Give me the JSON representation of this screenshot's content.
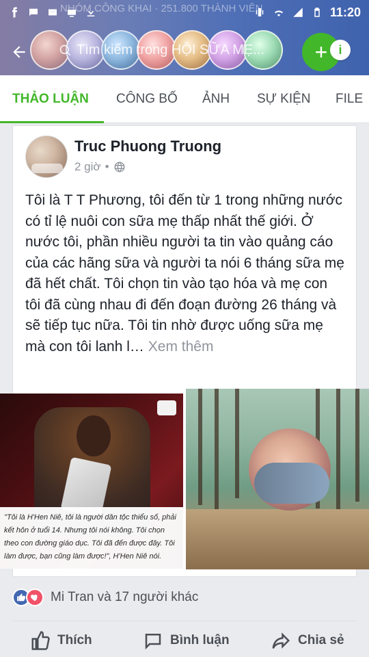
{
  "status_bar": {
    "time": "11:20",
    "group_marquee": "NHÓM CÔNG KHAI · 251.800 THÀNH VIÊN",
    "icons": [
      "facebook-icon",
      "message-icon",
      "gmail-icon",
      "tv-icon",
      "download-icon",
      "vibrate-icon",
      "wifi-icon",
      "signal-icon",
      "battery-icon"
    ]
  },
  "header": {
    "search_placeholder": "Tìm kiếm trong HỘI SỮA MẸ...",
    "info_label": "i",
    "plus_label": "+"
  },
  "tabs": [
    {
      "label": "THẢO LUẬN",
      "active": true
    },
    {
      "label": "CÔNG BỐ",
      "active": false
    },
    {
      "label": "ẢNH",
      "active": false
    },
    {
      "label": "SỰ KIỆN",
      "active": false
    },
    {
      "label": "FILE",
      "active": false
    }
  ],
  "post": {
    "author": "Truc Phuong Truong",
    "time": "2 giờ",
    "separator": "•",
    "body": "Tôi là T T Phương, tôi đến từ 1 trong những nước có tỉ lệ nuôi con sữa mẹ thấp nhất thế giới. Ở nước tôi, phần nhiều người ta tin vào quảng cáo của các hãng sữa và người ta nói 6 tháng sữa mẹ đã hết chất. Tôi chọn tin vào tạo hóa và mẹ con tôi đã cùng nhau đi đến đoạn đường 26 tháng và sẽ tiếp tục nữa. Tôi tin nhờ được uống sữa mẹ mà con tôi lanh l…",
    "see_more": "Xem thêm",
    "image_caption": "\"Tôi là H'Hen Niê, tôi là người dân tộc thiểu số, phải kết hôn ở tuổi 14. Nhưng tôi nói không. Tôi chọn theo con đường giáo dục. Tôi đã đến được đây. Tôi làm được, bạn cũng làm được!\", H'Hen Niê nói."
  },
  "reactions": {
    "text": "Mi Tran và 17 người khác"
  },
  "actions": {
    "like": "Thích",
    "comment": "Bình luận",
    "share": "Chia sẻ"
  },
  "colors": {
    "facebook_blue": "#4267b2",
    "green_accent": "#42b72a",
    "text_dark": "#1d2129",
    "text_muted": "#90949c"
  }
}
